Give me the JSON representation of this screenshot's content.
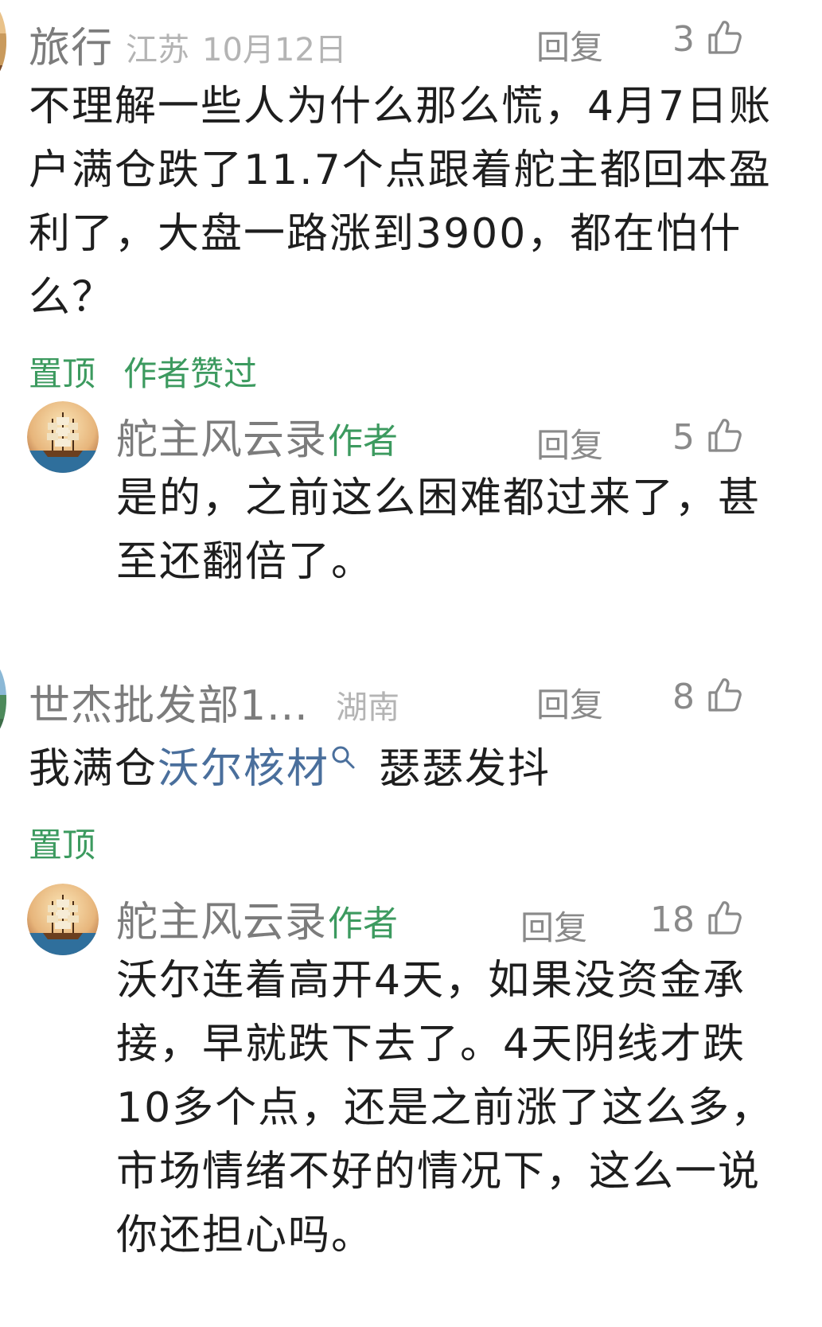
{
  "comments": [
    {
      "username": "旅行",
      "location": "江苏",
      "date": "10月12日",
      "reply_label": "回复",
      "likes": "3",
      "text": "不理解一些人为什么那么慌，4月7日账户满仓跌了11.7个点跟着舵主都回本盈利了，大盘一路涨到3900，都在怕什么？",
      "tags": [
        "置顶",
        "作者赞过"
      ],
      "reply": {
        "username": "舵主风云录",
        "badge": "作者",
        "reply_label": "回复",
        "likes": "5",
        "text": "是的，之前这么困难都过来了，甚至还翻倍了。"
      }
    },
    {
      "username": "世杰批发部1...",
      "location": "湖南",
      "reply_label": "回复",
      "likes": "8",
      "text_prefix": "我满仓",
      "text_link": "沃尔核材",
      "text_suffix": "瑟瑟发抖",
      "tags": [
        "置顶"
      ],
      "reply": {
        "username": "舵主风云录",
        "badge": "作者",
        "reply_label": "回复",
        "likes": "18",
        "text": "沃尔连着高开4天，如果没资金承接，早就跌下去了。4天阴线才跌10多个点，还是之前涨了这么多，市场情绪不好的情况下，这么一说你还担心吗。"
      }
    }
  ],
  "colors": {
    "accent_green": "#3c9a5f",
    "link_blue": "#4a6f9c",
    "meta_gray": "#b4b4b4",
    "username_gray": "#7c7c7c"
  },
  "icons": [
    "thumbs-up-icon",
    "search-icon",
    "ship-avatar"
  ]
}
